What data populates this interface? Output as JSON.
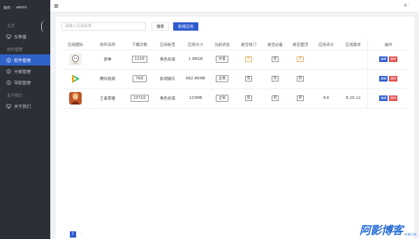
{
  "sidebar": {
    "brand_left": "软件",
    "brand_right": "admin",
    "groups": [
      {
        "title": "主页",
        "items": [
          {
            "label": "仪表盘",
            "icon": "monitor-icon",
            "active": false
          }
        ]
      },
      {
        "title": "软件管理",
        "items": [
          {
            "label": "软件管理",
            "icon": "info-circle-icon",
            "active": true
          },
          {
            "label": "分类管理",
            "icon": "info-circle-icon",
            "active": false
          },
          {
            "label": "导航管理",
            "icon": "info-circle-icon",
            "active": false
          }
        ]
      },
      {
        "title": "关于我们",
        "items": [
          {
            "label": "关于我们",
            "icon": "monitor-icon",
            "active": false
          }
        ]
      }
    ]
  },
  "toolbar": {
    "search_placeholder": "请输入应用名称",
    "search_label": "搜索",
    "add_label": "新增应用"
  },
  "table": {
    "headers": [
      "应用图标",
      "软件名称",
      "下载次数",
      "应用标签",
      "应用大小",
      "当前状态",
      "是否热门",
      "是否必备",
      "是否置顶",
      "应用评分",
      "应用版本",
      "操作"
    ],
    "rows": [
      {
        "name": "原神",
        "downloads": "123次",
        "tag": "角色扮演",
        "size": "1.96GB",
        "status": "开发",
        "hot": "否",
        "must": "是",
        "top": "否",
        "rating": "",
        "version": ""
      },
      {
        "name": "腾讯视频",
        "downloads": "79次",
        "tag": "影视娱乐",
        "size": "682.86MB",
        "status": "正常",
        "hot": "是",
        "must": "是",
        "top": "是",
        "rating": "",
        "version": ""
      },
      {
        "name": "王者荣耀",
        "downloads": "2372次",
        "tag": "角色扮演",
        "size": "123MB",
        "status": "正常",
        "hot": "是",
        "must": "是",
        "top": "是",
        "rating": "9.6",
        "version": "8.29.12"
      }
    ],
    "edit_label": "编辑",
    "delete_label": "删除"
  },
  "pager": {
    "current": "1"
  },
  "watermark": {
    "main": "阿影博客",
    "sub": "AYBK.CN"
  },
  "colors": {
    "accent": "#2f5bd0",
    "sidebar_bg": "#2b2f36",
    "danger": "#e24f4f"
  }
}
